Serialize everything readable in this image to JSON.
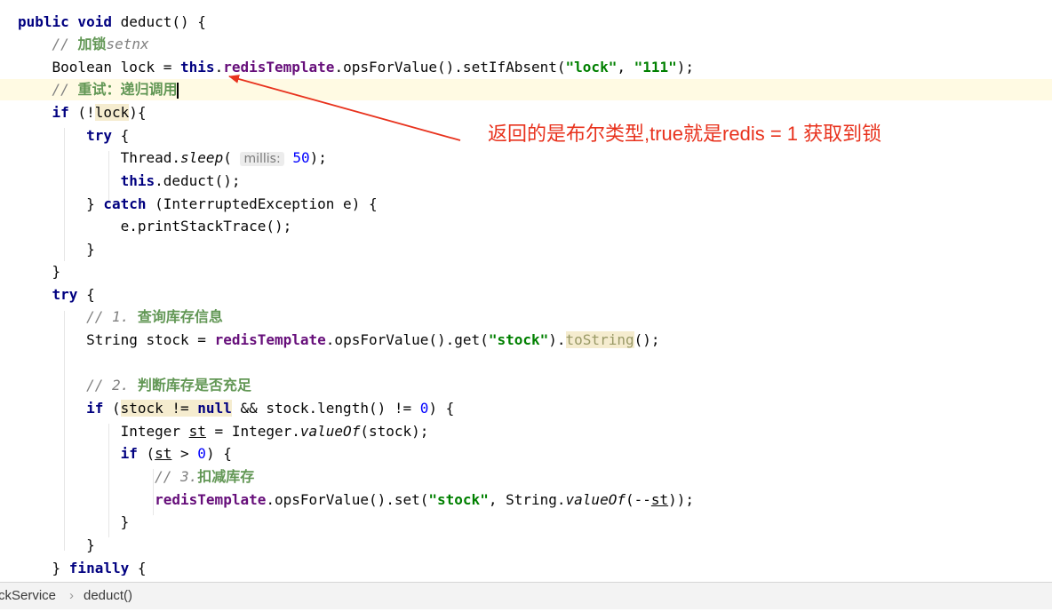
{
  "code_lines": [
    "public void deduct() {",
    "    // 加锁setnx",
    "    Boolean lock = this.redisTemplate.opsForValue().setIfAbsent(\"lock\", \"111\");",
    "    // 重试：递归调用",
    "    if (!lock){",
    "        try {",
    "            Thread.sleep( millis: 50);",
    "            this.deduct();",
    "        } catch (InterruptedException e) {",
    "            e.printStackTrace();",
    "        }",
    "    }",
    "    try {",
    "        // 1. 查询库存信息",
    "        String stock = redisTemplate.opsForValue().get(\"stock\").toString();",
    "",
    "        // 2. 判断库存是否充足",
    "        if (stock != null && stock.length() != 0) {",
    "            Integer st = Integer.valueOf(stock);",
    "            if (st > 0) {",
    "                // 3.扣减库存",
    "                redisTemplate.opsForValue().set(\"stock\", String.valueOf(--st));",
    "            }",
    "        }",
    "    } finally {"
  ],
  "annotation": {
    "text": "返回的是布尔类型,true就是redis = 1 获取到锁",
    "color": "#e8321d"
  },
  "breadcrumb": {
    "class_name": "ckService",
    "separator": "›",
    "method": "deduct()"
  }
}
